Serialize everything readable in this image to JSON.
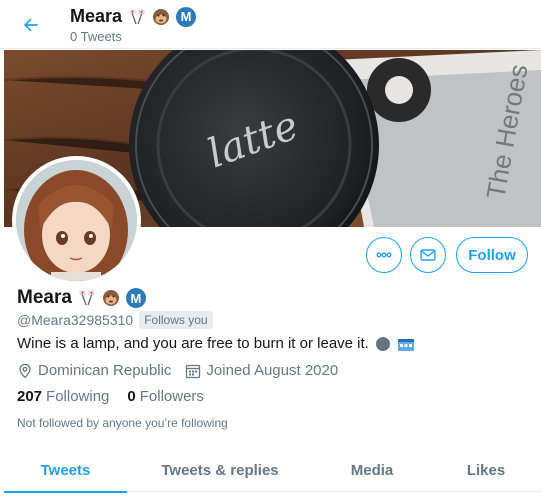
{
  "header": {
    "name": "Meara",
    "tweet_count": "0 Tweets"
  },
  "profile": {
    "name": "Meara",
    "handle": "@Meara32985310",
    "follows_you": "Follows you",
    "bio": "Wine is a lamp, and you are free to burn it or leave it.",
    "location": "Dominican Republic",
    "joined": "Joined August 2020",
    "following_count": "207",
    "following_label": "Following",
    "followers_count": "0",
    "followers_label": "Followers",
    "not_followed": "Not followed by anyone you’re following",
    "name_badge": "M"
  },
  "actions": {
    "follow_label": "Follow"
  },
  "tabs": [
    {
      "label": "Tweets",
      "active": true
    },
    {
      "label": "Tweets & replies",
      "active": false
    },
    {
      "label": "Media",
      "active": false
    },
    {
      "label": "Likes",
      "active": false
    }
  ],
  "colors": {
    "accent": "#1da1f2",
    "muted": "#657786",
    "text": "#14171a",
    "border": "#e6ecf0"
  },
  "icons": [
    "back-arrow-icon",
    "crossed-flags-emoji",
    "monkey-face-emoji",
    "m-badge-icon",
    "more-options-icon",
    "message-icon",
    "location-pin-icon",
    "calendar-icon",
    "new-moon-emoji",
    "hotel-emoji"
  ]
}
